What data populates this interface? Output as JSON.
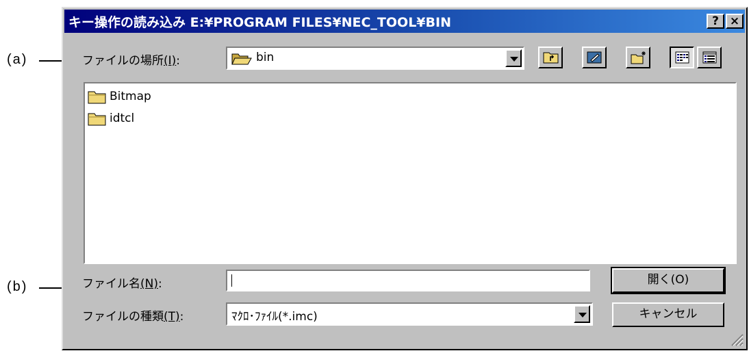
{
  "callouts": {
    "a": "(a)",
    "b": "(b)"
  },
  "dialog": {
    "title": "キー操作の読み込み E:¥PROGRAM FILES¥NEC_TOOL¥BIN",
    "help_button": "?",
    "close_button": "×"
  },
  "location": {
    "label": "ファイルの場所",
    "mnemonic": "(I)",
    "suffix": ":",
    "value": "bin"
  },
  "toolbar": [
    "up-one-level-icon",
    "desktop-icon",
    "new-folder-icon",
    "list-view-icon",
    "details-view-icon"
  ],
  "files": [
    {
      "name": "Bitmap",
      "type": "folder"
    },
    {
      "name": "idtcl",
      "type": "folder"
    }
  ],
  "filename": {
    "label": "ファイル名",
    "mnemonic": "(N)",
    "suffix": ":",
    "value": ""
  },
  "filetype": {
    "label": "ファイルの種類",
    "mnemonic": "(T)",
    "suffix": ":",
    "value": "ﾏｸﾛ･ﾌｧｲﾙ(*.imc)"
  },
  "buttons": {
    "open": "開く(O)",
    "cancel": "キャンセル"
  },
  "colors": {
    "title_start": "#00007b",
    "title_end": "#3b89e0",
    "face": "#c0c0c0",
    "folder": "#f0d878"
  }
}
